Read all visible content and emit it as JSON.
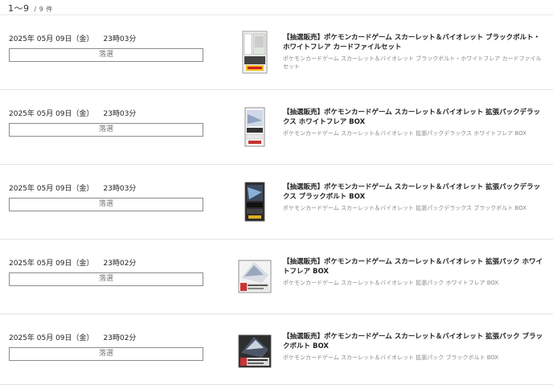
{
  "pagination": {
    "range": "1～9",
    "total": "/ 9 件"
  },
  "result_label": "落選",
  "entries": [
    {
      "date": "2025年 05月 09日（金）",
      "time": "23時03分",
      "result": "落選",
      "title": "【抽選販売】ポケモンカードゲーム スカーレット＆バイオレット ブラックボルト・ホワイトフレア カードファイルセット",
      "subtitle": "ポケモンカードゲーム スカーレット＆バイオレット ブラックボルト・ホワイトフレア カードファイルセット",
      "image": "card-file-set-package"
    },
    {
      "date": "2025年 05月 09日（金）",
      "time": "23時03分",
      "result": "落選",
      "title": "【抽選販売】ポケモンカードゲーム スカーレット＆バイオレット 拡張パックデラックス ホワイトフレア BOX",
      "subtitle": "ポケモンカードゲーム スカーレット＆バイオレット 拡張パックデラックス ホワイトフレア BOX",
      "image": "white-flare-deluxe-box"
    },
    {
      "date": "2025年 05月 09日（金）",
      "time": "23時03分",
      "result": "落選",
      "title": "【抽選販売】ポケモンカードゲーム スカーレット＆バイオレット 拡張パックデラックス ブラックボルト BOX",
      "subtitle": "ポケモンカードゲーム スカーレット＆バイオレット 拡張パックデラックス ブラックボルト BOX",
      "image": "black-bolt-deluxe-box"
    },
    {
      "date": "2025年 05月 09日（金）",
      "time": "23時02分",
      "result": "落選",
      "title": "【抽選販売】ポケモンカードゲーム スカーレット＆バイオレット 拡張パック ホワイトフレア BOX",
      "subtitle": "ポケモンカードゲーム スカーレット＆バイオレット 拡張パック ホワイトフレア BOX",
      "image": "white-flare-box"
    },
    {
      "date": "2025年 05月 09日（金）",
      "time": "23時02分",
      "result": "落選",
      "title": "【抽選販売】ポケモンカードゲーム スカーレット＆バイオレット 拡張パック ブラックボルト BOX",
      "subtitle": "ポケモンカードゲーム スカーレット＆バイオレット 拡張パック ブラックボルト BOX",
      "image": "black-bolt-box"
    }
  ]
}
